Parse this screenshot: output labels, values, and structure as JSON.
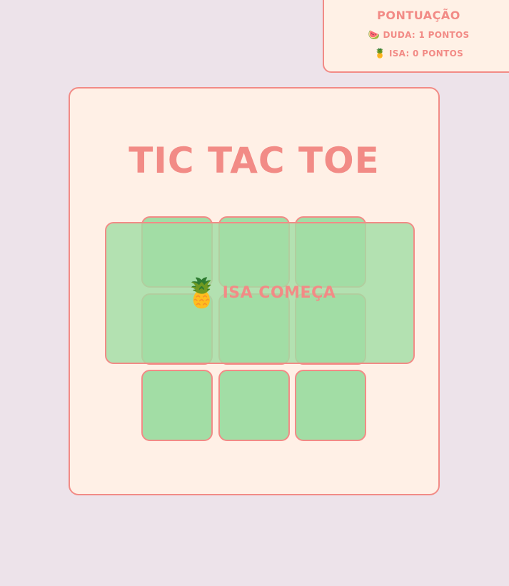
{
  "scoreboard": {
    "title": "Pontuação",
    "players": [
      {
        "icon": "🍉",
        "icon_name": "watermelon-icon",
        "text": "Duda: 1 pontos"
      },
      {
        "icon": "🍍",
        "icon_name": "pineapple-icon",
        "text": "Isa: 0 pontos"
      }
    ]
  },
  "game": {
    "title": "Tic Tac Toe",
    "board": [
      "",
      "",
      "",
      "",
      "",
      "",
      "",
      "",
      ""
    ]
  },
  "overlay": {
    "icon": "🍍",
    "icon_name": "pineapple-icon",
    "message": "Isa começa"
  },
  "colors": {
    "background": "#ede3ea",
    "panel": "#fff0e6",
    "accent": "#f28b86",
    "cell": "#a2dda5"
  }
}
